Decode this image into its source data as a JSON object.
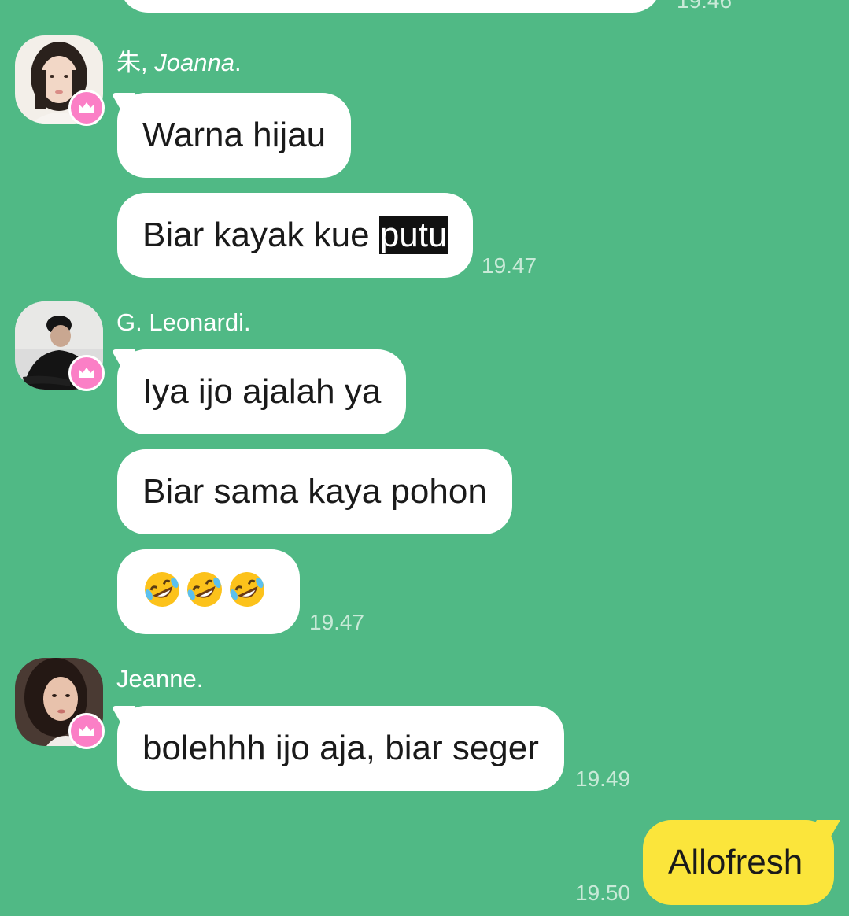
{
  "chat": {
    "previous": {
      "time": "19.46"
    },
    "groups": [
      {
        "sender_main": "朱,",
        "sender_italic": "Joanna",
        "sender_suffix": ".",
        "messages": [
          "Warna hijau",
          "Biar kayak kue",
          "putu"
        ],
        "time": "19.47"
      },
      {
        "sender": "G. Leonardi.",
        "messages": [
          "Iya ijo ajalah ya",
          "Biar sama kaya pohon",
          "🤣🤣🤣"
        ],
        "time": "19.47"
      },
      {
        "sender": "Jeanne.",
        "messages": [
          "bolehhh ijo aja, biar seger"
        ],
        "time": "19.49"
      }
    ],
    "mine": {
      "text": "Allofresh",
      "time": "19.50"
    }
  },
  "colors": {
    "background": "#50b985",
    "bubble": "#ffffff",
    "my_bubble": "#fbe53b",
    "crown_badge": "#fb7fc6",
    "timestamp": "#c9ead8"
  },
  "icons": [
    "crown-icon",
    "rofl-emoji"
  ]
}
